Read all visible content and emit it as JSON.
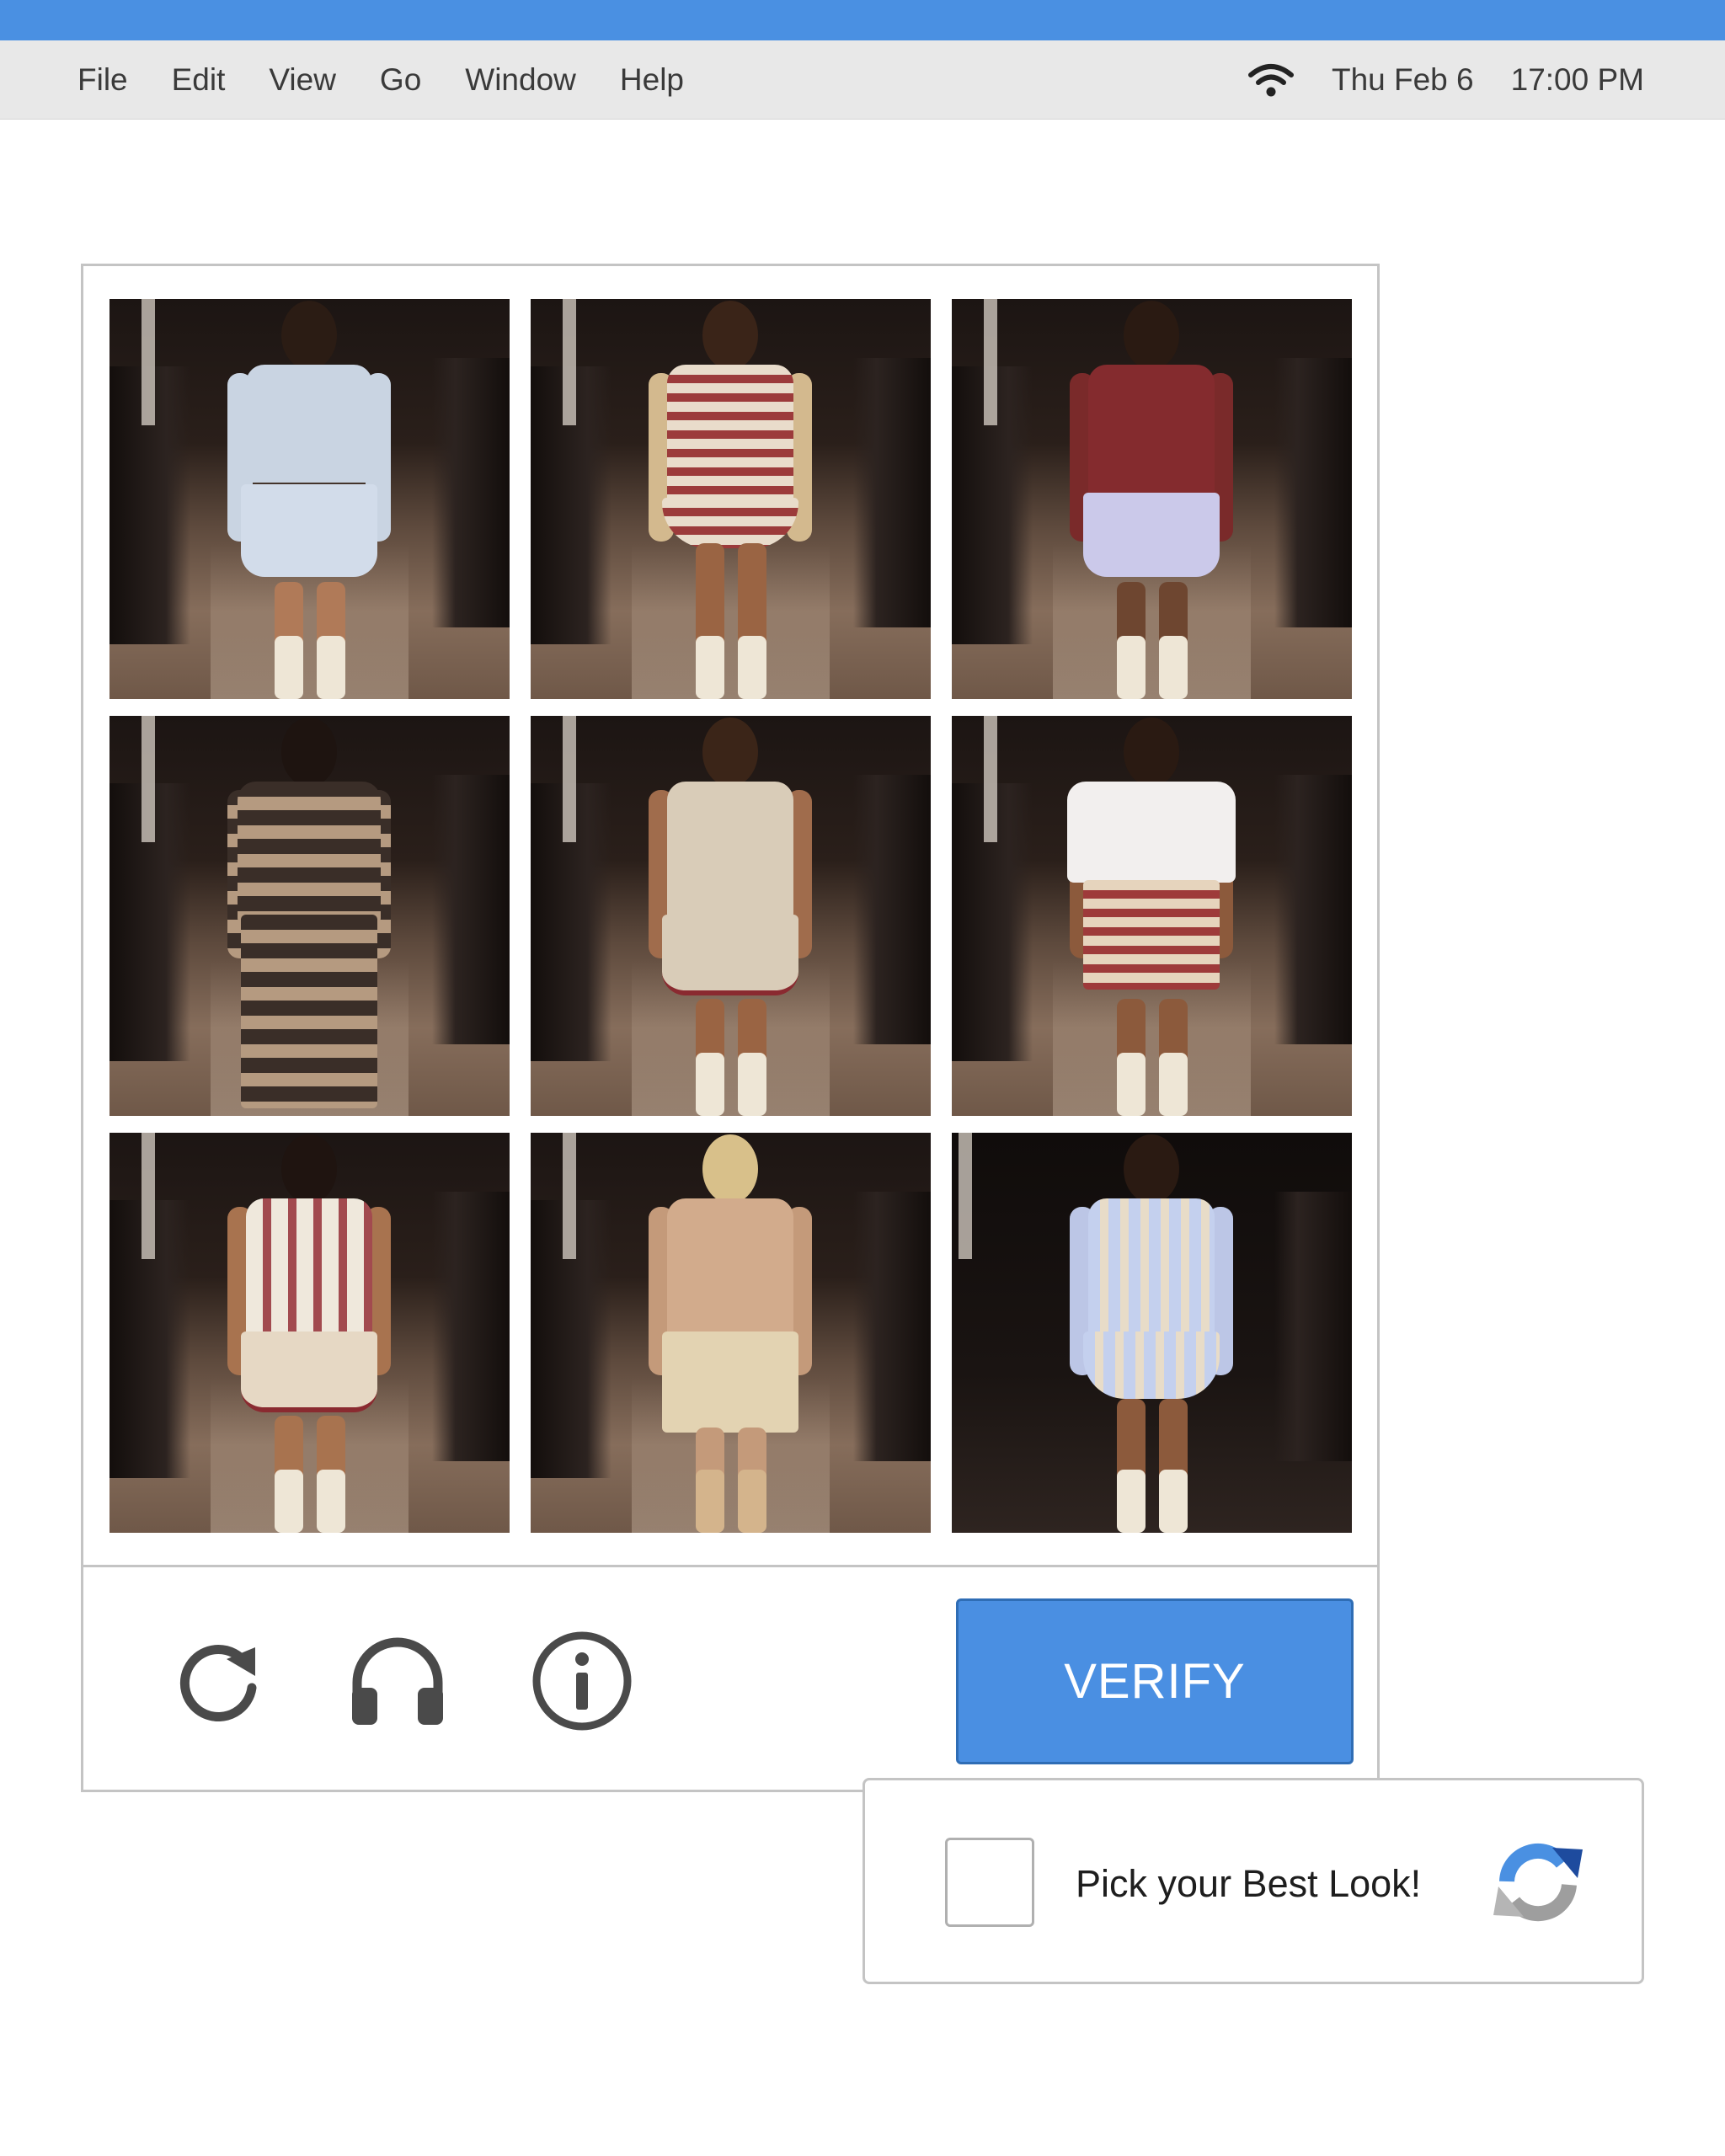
{
  "menu_bar": {
    "items": [
      "File",
      "Edit",
      "View",
      "Go",
      "Window",
      "Help"
    ],
    "wifi_icon": "wifi-icon",
    "date": "Thu Feb 6",
    "time": "17:00 PM"
  },
  "captcha": {
    "tiles": [
      {
        "look": "light blue cropped sweatshirt with flared mini skirt"
      },
      {
        "look": "beige shrug cardigan over striped bodysuit"
      },
      {
        "look": "burgundy knit top with lavender satin shorts"
      },
      {
        "look": "brown ombre stripe sweater and wide trousers"
      },
      {
        "look": "oatmeal knit mini dress with varsity G patch"
      },
      {
        "look": "white draped top with striped knit shorts"
      },
      {
        "look": "fringed white vest with flared knit mini skirt"
      },
      {
        "look": "sheer nude harness top with silk shorts"
      },
      {
        "look": "pastel striped long-sleeve flared mini dress"
      }
    ],
    "actions": {
      "refresh_icon": "refresh-icon",
      "audio_icon": "headphones-icon",
      "info_icon": "info-icon",
      "verify_label": "VERIFY"
    }
  },
  "recaptcha": {
    "label": "Pick your Best Look!",
    "logo_icon": "recaptcha-logo-icon"
  },
  "colors": {
    "title_bar": "#4a90e2",
    "menu_bar": "#e8e8e8",
    "verify_button": "#4a8fe2",
    "border": "#c4c4c4"
  }
}
